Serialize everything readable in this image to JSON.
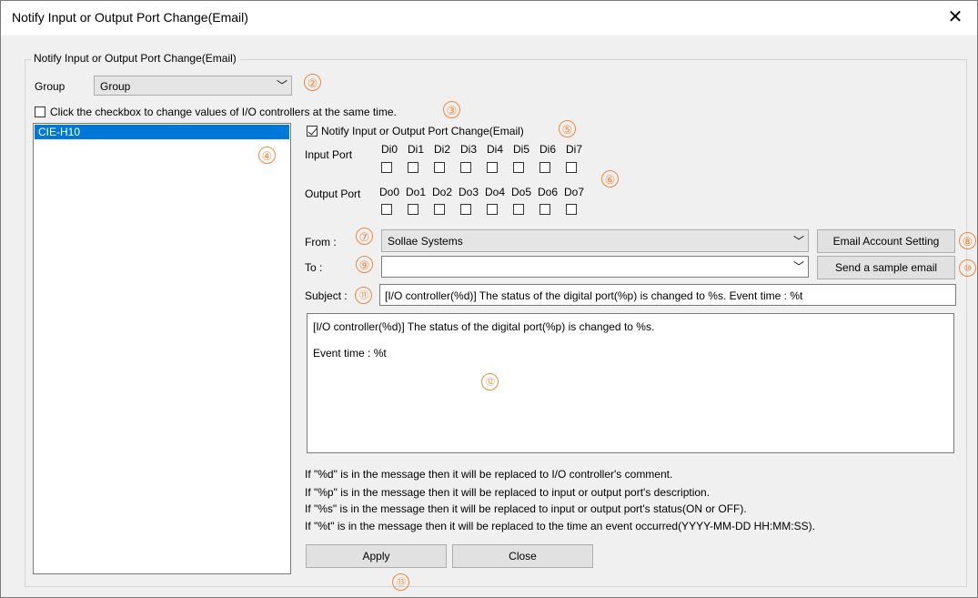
{
  "window": {
    "title": "Notify Input or Output Port Change(Email)",
    "close_glyph": "✕"
  },
  "groupbox": {
    "legend": "Notify Input or Output Port Change(Email)"
  },
  "group": {
    "label": "Group",
    "value": "Group"
  },
  "same_time": {
    "label": "Click the checkbox to change values of I/O controllers at the same time.",
    "checked": false
  },
  "controllers": {
    "items": [
      "CIE-H10"
    ],
    "selected": 0
  },
  "notify": {
    "label": "Notify Input or Output Port Change(Email)",
    "checked": true
  },
  "input_port": {
    "label": "Input Port",
    "ports": [
      "Di0",
      "Di1",
      "Di2",
      "Di3",
      "Di4",
      "Di5",
      "Di6",
      "Di7"
    ]
  },
  "output_port": {
    "label": "Output Port",
    "ports": [
      "Do0",
      "Do1",
      "Do2",
      "Do3",
      "Do4",
      "Do5",
      "Do6",
      "Do7"
    ]
  },
  "from": {
    "label": "From :",
    "value": "Sollae Systems",
    "button": "Email Account Setting"
  },
  "to": {
    "label": "To :",
    "value": "",
    "button": "Send a sample email"
  },
  "subject": {
    "label": "Subject :",
    "value": "[I/O controller(%d)] The status of the digital port(%p) is changed to %s. Event time : %t"
  },
  "message": {
    "line1": "[I/O controller(%d)] The status of the digital port(%p) is changed to %s.",
    "line2": "Event time : %t"
  },
  "help": [
    "If \"%d\" is in the message then it will be replaced to I/O controller's comment.",
    "If \"%p\" is in the message then it will be replaced to input or output port's description.",
    "If \"%s\" is in the message then it will be replaced to input or output port's status(ON or OFF).",
    "If \"%t\" is in the message then it will be replaced to the time an event occurred(YYYY-MM-DD HH:MM:SS)."
  ],
  "buttons": {
    "apply": "Apply",
    "close": "Close"
  },
  "annotations": [
    "②",
    "③",
    "④",
    "⑤",
    "⑥",
    "⑦",
    "⑧",
    "⑨",
    "⑩",
    "⑪",
    "⑫",
    "⑬"
  ],
  "colors": {
    "selection": "#0078d7",
    "annotation": "#f0883a",
    "dialog_bg": "#f0f0f0"
  },
  "chevron_glyph": "﹀"
}
